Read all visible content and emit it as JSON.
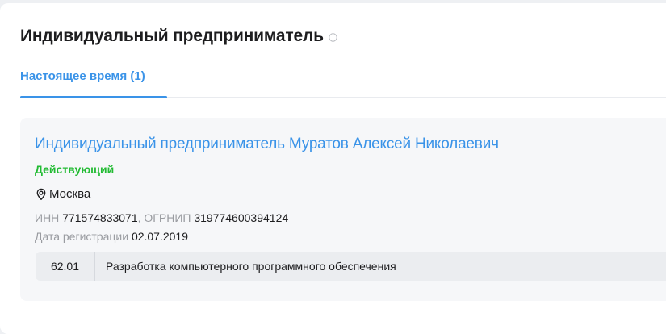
{
  "section": {
    "title": "Индивидуальный предприниматель",
    "info_icon": "info-circle-icon"
  },
  "tabs": [
    {
      "label": "Настоящее время (1)",
      "active": true
    }
  ],
  "entry": {
    "name": "Индивидуальный предприниматель Муратов Алексей Николаевич",
    "status": "Действующий",
    "location_icon": "map-pin-icon",
    "location": "Москва",
    "inn_label": "ИНН",
    "inn": "771574833071",
    "separator": ",",
    "ogrnip_label": "ОГРНИП",
    "ogrnip": "319774600394124",
    "reg_label": "Дата регистрации",
    "reg_date": "02.07.2019",
    "activity": {
      "code": "62.01",
      "description": "Разработка компьютерного программного обеспечения"
    }
  },
  "colors": {
    "accent": "#3a93e8",
    "status_active": "#22bb33",
    "muted_text": "#9a9ca1",
    "text": "#1d1d1f"
  }
}
